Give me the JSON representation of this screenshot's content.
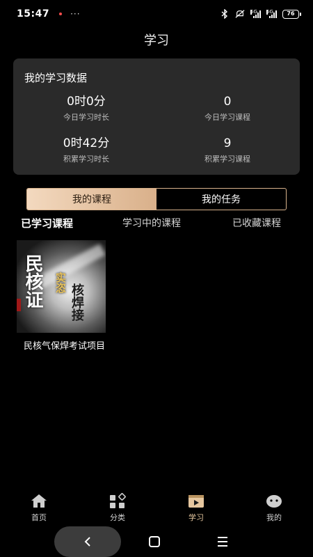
{
  "status": {
    "time": "15:47",
    "more": "···",
    "signal_label_1": "5G",
    "signal_label_2": "5G",
    "battery": "76"
  },
  "header": {
    "title": "学习"
  },
  "stats": {
    "title": "我的学习数据",
    "today_time": {
      "value": "0时0分",
      "label": "今日学习时长"
    },
    "today_courses": {
      "value": "0",
      "label": "今日学习课程"
    },
    "total_time": {
      "value": "0时42分",
      "label": "积累学习时长"
    },
    "total_courses": {
      "value": "9",
      "label": "积累学习课程"
    }
  },
  "segment": {
    "tabs": [
      "我的课程",
      "我的任务"
    ],
    "active": 0
  },
  "subtabs": {
    "items": [
      "已学习课程",
      "学习中的课程",
      "已收藏课程"
    ],
    "active": 0
  },
  "courses": [
    {
      "name": "民核气保焊考试项目",
      "cover_text_big": "民核证",
      "cover_text_gold": "实恣",
      "cover_text_dark": "核焊接"
    }
  ],
  "bottom_nav": {
    "items": [
      {
        "label": "首页",
        "icon": "home-icon"
      },
      {
        "label": "分类",
        "icon": "category-icon"
      },
      {
        "label": "学习",
        "icon": "video-play-icon"
      },
      {
        "label": "我的",
        "icon": "profile-icon"
      }
    ],
    "active": 2
  },
  "colors": {
    "accent": "#d9b08a",
    "card_bg": "#2a2a2a",
    "background": "#000000"
  }
}
